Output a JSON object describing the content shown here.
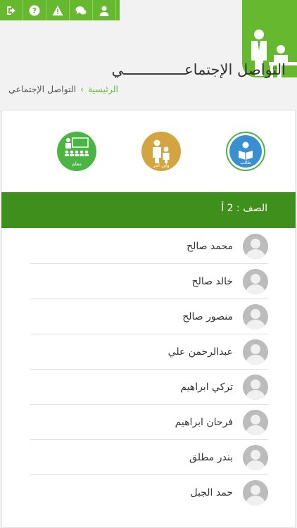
{
  "toolbar": {
    "icons": [
      "logout-icon",
      "help-icon",
      "alert-icon",
      "chat-icon",
      "user-icon"
    ]
  },
  "header": {
    "title": "التواصل الإجتماعــــــــــــــي",
    "breadcrumb": {
      "home": "الرئيسية",
      "current": "التواصل الإجتماعي"
    }
  },
  "roles": [
    {
      "name": "student",
      "label": "طالب",
      "color": "#3a8fd0"
    },
    {
      "name": "parent",
      "label": "ولي أمر",
      "color": "#d4a440"
    },
    {
      "name": "teacher",
      "label": "معلم",
      "color": "#4bb543"
    }
  ],
  "class_label": "الصف : 2 أ",
  "students": [
    {
      "name": "محمد صالح"
    },
    {
      "name": "خالد صالح"
    },
    {
      "name": "منصور صالح"
    },
    {
      "name": "عبدالرحمن علي"
    },
    {
      "name": "تركي ابراهيم"
    },
    {
      "name": "فرحان ابراهيم"
    },
    {
      "name": "بندر مطلق"
    },
    {
      "name": "حمد الجبل"
    }
  ],
  "colors": {
    "accent": "#66b82e",
    "class_bar": "#3e8f1c"
  }
}
